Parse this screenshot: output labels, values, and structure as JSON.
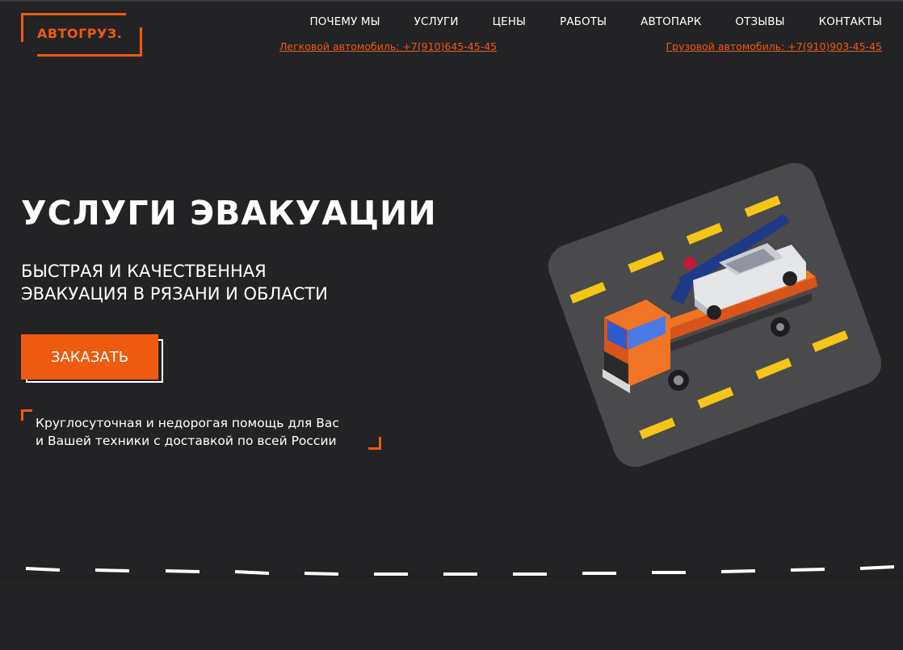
{
  "logo": {
    "text": "АВТОГРУЗ."
  },
  "nav": {
    "items": [
      "ПОЧЕМУ МЫ",
      "УСЛУГИ",
      "ЦЕНЫ",
      "РАБОТЫ",
      "АВТОПАРК",
      "ОТЗЫВЫ",
      "КОНТАКТЫ"
    ]
  },
  "phones": {
    "car": "Легковой автомобиль: +7(910)645-45-45",
    "truck": "Грузовой автомобиль: +7(910)903-45-45"
  },
  "hero": {
    "title": "УСЛУГИ ЭВАКУАЦИИ",
    "subtitle_line1": "БЫСТРАЯ И КАЧЕСТВЕННАЯ",
    "subtitle_line2": "ЭВАКУАЦИЯ В РЯЗАНИ И ОБЛАСТИ",
    "order_button": "ЗАКАЗАТЬ",
    "note_line1": "Круглосуточная и недорогая помощь для Вас",
    "note_line2": "и Вашей техники с доставкой по всей России"
  },
  "colors": {
    "background": "#232325",
    "accent": "#ee5a10",
    "text": "#ffffff",
    "road": "#4a4a4c",
    "lane_marking": "#f5c518"
  },
  "icons": [
    "tow-truck-illustration",
    "road-marking-icon"
  ]
}
